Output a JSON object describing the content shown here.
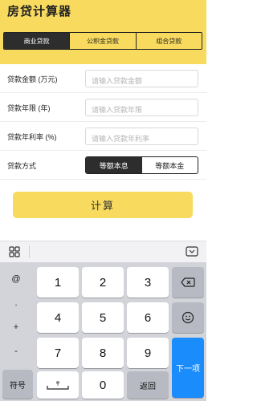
{
  "app": {
    "title": "房贷计算器"
  },
  "tabs": [
    {
      "label": "商业贷款",
      "active": true
    },
    {
      "label": "公积金贷款",
      "active": false
    },
    {
      "label": "组合贷款",
      "active": false
    }
  ],
  "form": {
    "amount": {
      "label": "贷款金额 (万元)",
      "placeholder": "请输入贷款金额"
    },
    "years": {
      "label": "贷款年限 (年)",
      "placeholder": "请输入贷款年限"
    },
    "rate": {
      "label": "贷款年利率 (%)",
      "placeholder": "请输入贷款年利率"
    },
    "method": {
      "label": "贷款方式",
      "options": [
        "等额本息",
        "等额本金"
      ],
      "selected": "等额本息"
    }
  },
  "calculate": {
    "label": "计算"
  },
  "keyboard": {
    "symbols": [
      "@",
      ".",
      "+",
      "-"
    ],
    "digits": [
      "1",
      "2",
      "3",
      "4",
      "5",
      "6",
      "7",
      "8",
      "9",
      "0"
    ],
    "symbol_mode": "符号",
    "back": "返回",
    "next": "下一项",
    "space_icon": "space-bar-icon",
    "backspace_icon": "backspace-icon",
    "emoji_icon": "emoji-icon",
    "grid_icon": "grid-icon",
    "hide_icon": "keyboard-hide-icon"
  },
  "colors": {
    "accent": "#f8db5e",
    "dark": "#2d2d2d",
    "next_key": "#1a8cfb"
  }
}
